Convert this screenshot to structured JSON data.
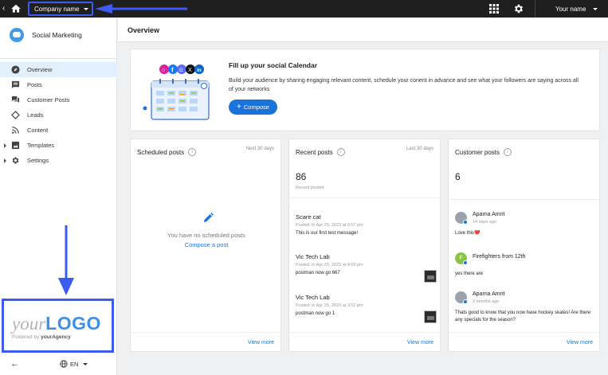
{
  "topbar": {
    "company_name": "Company name",
    "user_name": "Your name"
  },
  "sidebar": {
    "app_title": "Social Marketing",
    "items": [
      {
        "label": "Overview",
        "icon": "compass-icon",
        "active": true
      },
      {
        "label": "Posts",
        "icon": "message-icon"
      },
      {
        "label": "Customer Posts",
        "icon": "chat-icon"
      },
      {
        "label": "Leads",
        "icon": "diamond-icon"
      },
      {
        "label": "Content",
        "icon": "rss-icon"
      },
      {
        "label": "Templates",
        "icon": "image-icon",
        "expandable": true
      },
      {
        "label": "Settings",
        "icon": "gear-icon",
        "expandable": true
      }
    ],
    "logo": {
      "your": "your",
      "logo": "LOGO",
      "powered_by": "Powered by",
      "agency": "yourAgency"
    },
    "language": "EN"
  },
  "main": {
    "page_title": "Overview",
    "promo": {
      "title": "Fill up your social Calendar",
      "description": "Build your audience by sharing engaging relevant content, schedule your conent in advance and see what your followers are saying across all of your networks",
      "button": "Compose"
    },
    "scheduled": {
      "title": "Scheduled posts",
      "range": "Next 30 days",
      "empty_text": "You have no scheduled posts",
      "link": "Compose a post",
      "view_more": "View more"
    },
    "recent": {
      "title": "Recent posts",
      "range": "Last 30 days",
      "count": "86",
      "count_label": "Recent posted",
      "posts": [
        {
          "name": "Scare cat",
          "meta": "Posted: in Apr 25, 2023 at 9:57 pm",
          "text": "This is our first test message!"
        },
        {
          "name": "Vic Tech Lab",
          "meta": "Posted: in Apr 25, 2023 at 4:09 pm",
          "text": "postman now go 667"
        },
        {
          "name": "Vic Tech Lab",
          "meta": "Posted: in Apr 25, 2023 at 3:52 pm",
          "text": "postman now go 1"
        }
      ],
      "view_more": "View more"
    },
    "customer": {
      "title": "Customer posts",
      "count": "6",
      "posts": [
        {
          "name": "Aparna Amrit",
          "meta": "14 days ago",
          "text": "Love this",
          "emoji": "❤️"
        },
        {
          "name": "Firefighters from 12th",
          "meta": "",
          "text": "yes there are",
          "initial": "F"
        },
        {
          "name": "Aparna Amrit",
          "meta": "3 months ago",
          "text": "Thats good to know that you now have hockey skates! Are there any specials for the season?"
        }
      ],
      "view_more": "View more"
    }
  },
  "colors": {
    "accent": "#1a73d9",
    "highlight_border": "#3b5bf3",
    "topbar": "#1f1f1f",
    "active_nav": "#e2effc"
  }
}
